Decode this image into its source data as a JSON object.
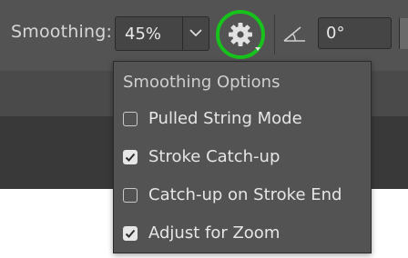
{
  "options_bar": {
    "smoothing_label": "Smoothing:",
    "smoothing_value": "45%",
    "angle_value": "0°",
    "gear_highlight_color": "#17c21c"
  },
  "popover": {
    "title": "Smoothing Options",
    "items": [
      {
        "label": "Pulled String Mode",
        "checked": false
      },
      {
        "label": "Stroke Catch-up",
        "checked": true
      },
      {
        "label": "Catch-up on Stroke End",
        "checked": false
      },
      {
        "label": "Adjust for Zoom",
        "checked": true
      }
    ]
  },
  "icons": {
    "dropdown": "chevron-down-icon",
    "settings": "gear-icon",
    "angle": "angle-icon",
    "check": "checkmark-icon"
  }
}
